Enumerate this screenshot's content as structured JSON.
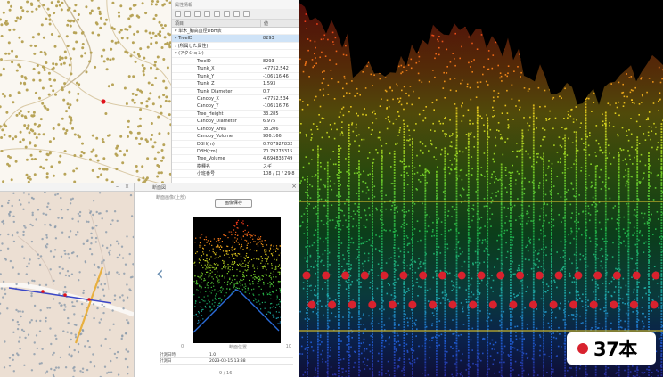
{
  "colors": {
    "map_dot": "#b8a458",
    "selected_tree": "#e0111a",
    "contour": "#d9c9a5",
    "lidar_bg": "#000000",
    "count_dot": "#d8222e",
    "reference_line": "#c8b32c"
  },
  "attribute_panel": {
    "title": "属性情報",
    "header_field": "項目",
    "header_value": "値",
    "toolbar_icons": [
      "layers-icon",
      "select-icon",
      "copy-icon",
      "delete-icon",
      "edit-icon",
      "filter-icon",
      "undo-icon",
      "zoom-icon"
    ],
    "rows": [
      {
        "key": "▾ 単木_胸高直径DBH表",
        "value": ""
      },
      {
        "key": "  ▾ TreeID",
        "value": "8293"
      },
      {
        "key": "     › (所属した属性)",
        "value": ""
      },
      {
        "key": "     ▾ (アクション)",
        "value": ""
      },
      {
        "key": "TreeID",
        "value": "8293"
      },
      {
        "key": "Trunk_X",
        "value": "-47752.542"
      },
      {
        "key": "Trunk_Y",
        "value": "-106116.46"
      },
      {
        "key": "Trunk_Z",
        "value": "1.593"
      },
      {
        "key": "Trunk_Diameter",
        "value": "0.7"
      },
      {
        "key": "Canopy_X",
        "value": "-47752.534"
      },
      {
        "key": "Canopy_Y",
        "value": "-106116.76"
      },
      {
        "key": "Tree_Height",
        "value": "33.285"
      },
      {
        "key": "Canopy_Diameter",
        "value": "6.975"
      },
      {
        "key": "Canopy_Area",
        "value": "38.206"
      },
      {
        "key": "Canopy_Volume",
        "value": "986.166"
      },
      {
        "key": "DBH(m)",
        "value": "0.707927832"
      },
      {
        "key": "DBH(cm)",
        "value": "70.79278315"
      },
      {
        "key": "Tree_Volume",
        "value": "4.694833749"
      },
      {
        "key": "樹種名",
        "value": "スギ"
      },
      {
        "key": "小班番号",
        "value": "108 / 口 / 29-8"
      }
    ]
  },
  "bottom_map": {
    "window_buttons": [
      "–",
      "×"
    ]
  },
  "viewer": {
    "title": "断面図",
    "subtitle": "断面画像(上部)",
    "button_label": "画像保存",
    "nav_prev": "‹",
    "close": "×",
    "slider_min": "0",
    "slider_max": "10",
    "slider_label": "断面位置",
    "table": [
      {
        "label": "計測日時",
        "value": "1.0"
      },
      {
        "label": "計測日",
        "value": "2023-03-15 13:38"
      }
    ],
    "page": "9 / 16"
  },
  "lidar": {
    "count_label": "37本",
    "detected_trees": 37
  }
}
